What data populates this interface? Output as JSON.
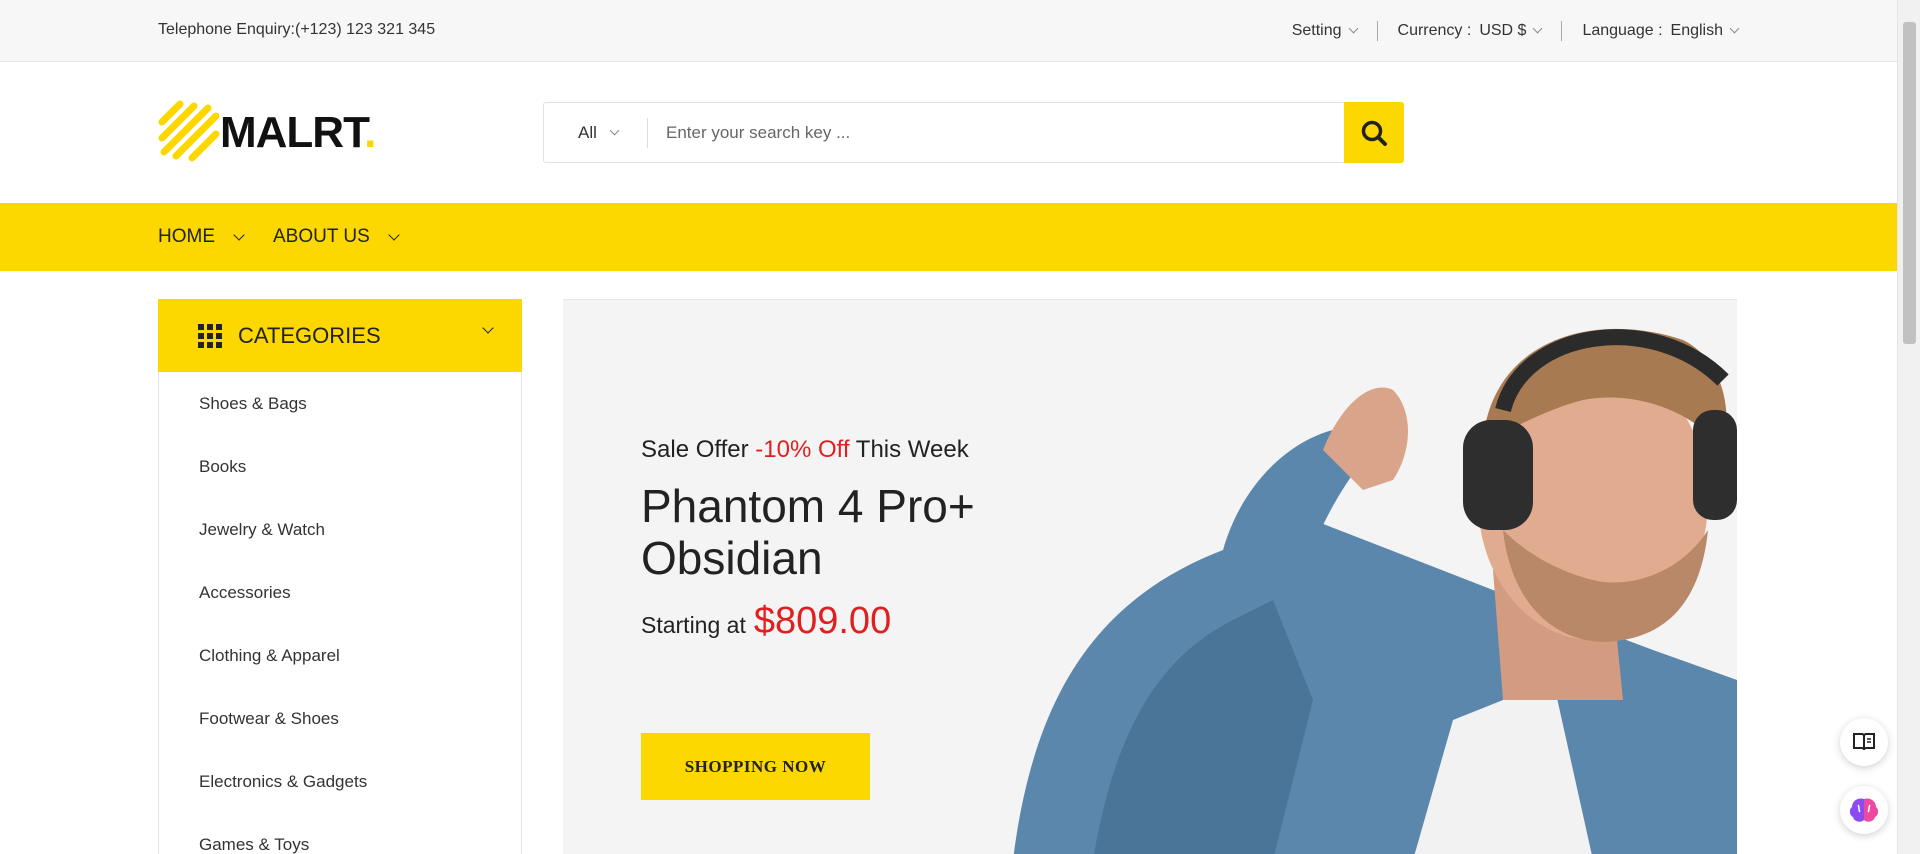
{
  "topbar": {
    "phone": "Telephone Enquiry:(+123) 123 321 345",
    "setting_label": "Setting",
    "currency_label": "Currency :",
    "currency_value": "USD $",
    "language_label": "Language :",
    "language_value": "English"
  },
  "logo": {
    "text": "MALRT",
    "dot": ".",
    "accent": "#fcd700"
  },
  "search": {
    "category": "All",
    "placeholder": "Enter your search key ...",
    "button_icon": "search-icon"
  },
  "nav": {
    "items": [
      {
        "label": "HOME"
      },
      {
        "label": "ABOUT US"
      }
    ]
  },
  "categories": {
    "title": "CATEGORIES",
    "items": [
      "Shoes & Bags",
      "Books",
      "Jewelry & Watch",
      "Accessories",
      "Clothing & Apparel",
      "Footwear & Shoes",
      "Electronics & Gadgets",
      "Games & Toys"
    ]
  },
  "hero": {
    "sale_prefix": "Sale Offer ",
    "sale_off": "-10% Off",
    "sale_suffix": " This Week",
    "title_line1": "Phantom 4 Pro+",
    "title_line2": "Obsidian",
    "price_label": "Starting at",
    "price": "$809.00",
    "cta": "SHOPPING NOW"
  },
  "colors": {
    "brand_yellow": "#fcd700",
    "sale_red": "#e02020"
  }
}
